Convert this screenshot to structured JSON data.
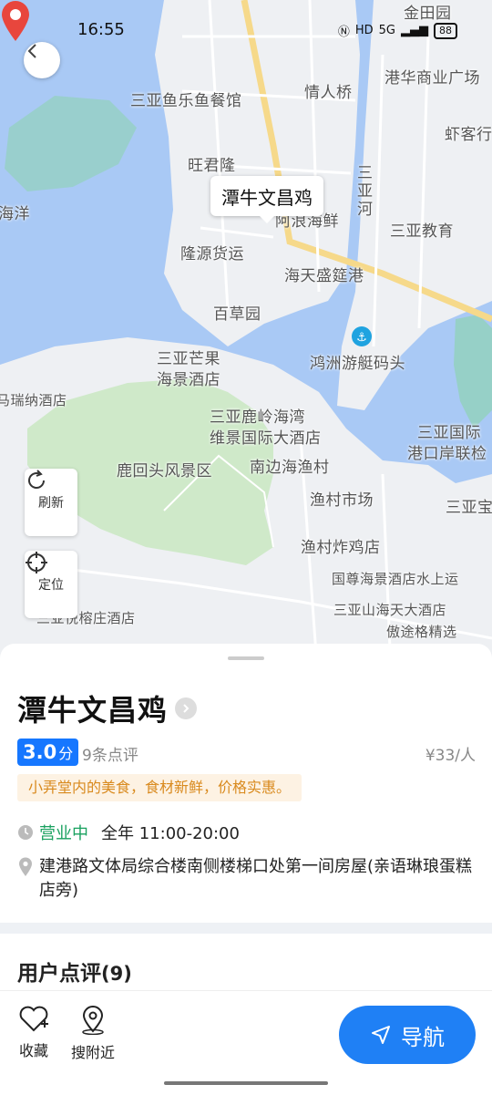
{
  "status_bar": {
    "time": "16:55",
    "net": "5G",
    "battery": "88"
  },
  "map": {
    "callout": "潭牛文昌鸡",
    "labels": [
      "金田园",
      "港华商业广场",
      "三亚鱼乐鱼餐馆",
      "情人桥",
      "虾客行",
      "旺君隆",
      "三亚河",
      "海洋",
      "潭牛文昌鸡",
      "三亚教育",
      "隆源货运",
      "海天盛筵港",
      "百草园",
      "鸿洲游艇码头",
      "三亚芒果",
      "海景酒店",
      "马瑞纳酒店",
      "三亚鹿岭海湾",
      "维景国际大酒店",
      "三亚国际",
      "港口岸联检",
      "鹿回头风景区",
      "南边海渔村",
      "渔村市场",
      "三亚宝",
      "渔村炸鸡店",
      "国尊海景酒店水上运",
      "三亚山海天大酒店",
      "三亚悦榕庄酒店",
      "傲途格精选",
      "阿浪海鲜"
    ],
    "tools": {
      "refresh": "刷新",
      "locate": "定位"
    }
  },
  "poi": {
    "name": "潭牛文昌鸡",
    "score": "3.0",
    "score_unit": "分",
    "review_count": "9条点评",
    "price": "¥33/人",
    "tagline": "小弄堂内的美食，食材新鲜，价格实惠。",
    "status": "营业中",
    "hours": "全年 11:00-20:00",
    "address": "建港路文体局综合楼南侧楼梯口处第一间房屋(亲语琳琅蛋糕店旁)"
  },
  "reviews_section": {
    "title": "用户点评",
    "count": "(9)"
  },
  "actions": {
    "favorite": "收藏",
    "nearby": "搜附近",
    "navigate": "导航"
  },
  "colors": {
    "accent": "#1f80f5",
    "open_green": "#19a15f",
    "pin_red": "#e8463d",
    "water": "#a9c9f5"
  }
}
